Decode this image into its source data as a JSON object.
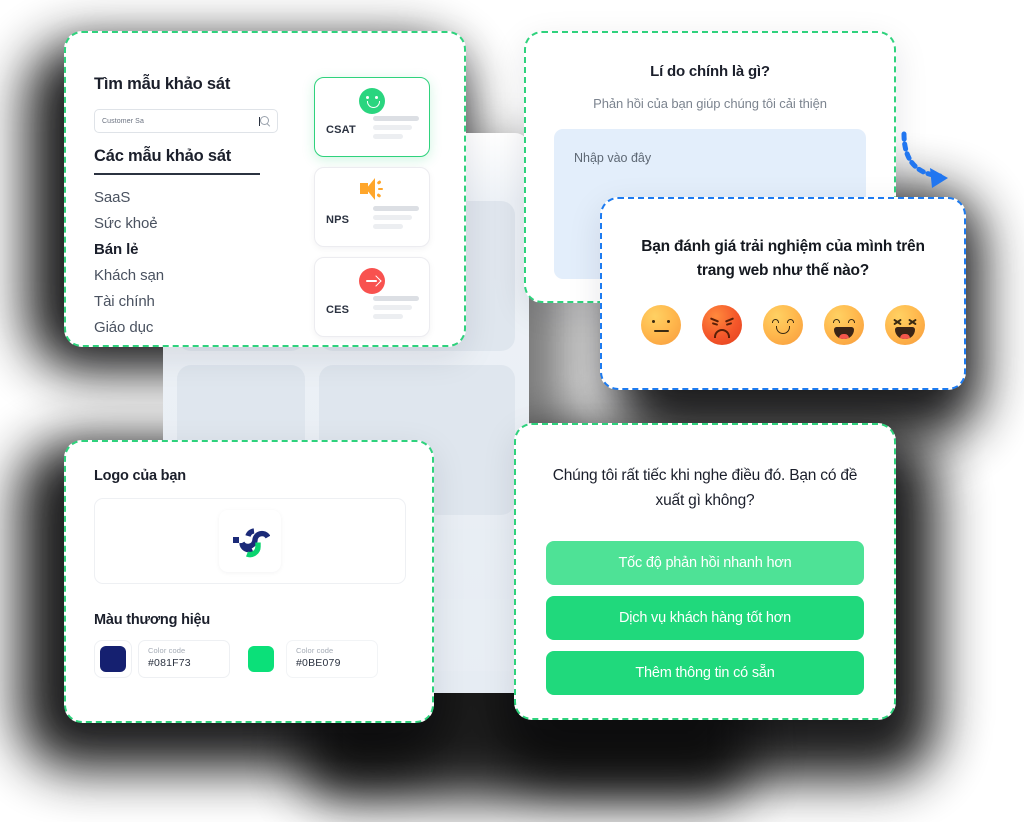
{
  "templates_card": {
    "title": "Tìm mẫu khảo sát",
    "search": {
      "value": "Customer Sa",
      "placeholder": "Customer Sa"
    },
    "list_heading": "Các mẫu khảo sát",
    "items": [
      {
        "label": "SaaS",
        "selected": false
      },
      {
        "label": "Sức khoẻ",
        "selected": false
      },
      {
        "label": "Bán lẻ",
        "selected": true
      },
      {
        "label": "Khách sạn",
        "selected": false
      },
      {
        "label": "Tài chính",
        "selected": false
      },
      {
        "label": "Giáo dục",
        "selected": false
      }
    ],
    "types": [
      {
        "label": "CSAT",
        "icon": "smile-icon",
        "active": true
      },
      {
        "label": "NPS",
        "icon": "speaker-icon",
        "active": false
      },
      {
        "label": "CES",
        "icon": "arrow-right-icon",
        "active": false
      }
    ]
  },
  "reason_card": {
    "question": "Lí do chính là gì?",
    "subtitle": "Phản hồi của bạn giúp chúng tôi cải thiện",
    "input_placeholder": "Nhập vào đây"
  },
  "rating_card": {
    "question": "Bạn đánh giá trải nghiệm của mình trên trang web như thế nào?",
    "emojis": [
      {
        "name": "neutral-face-emoji"
      },
      {
        "name": "angry-face-emoji"
      },
      {
        "name": "smiling-face-emoji"
      },
      {
        "name": "laughing-face-emoji"
      },
      {
        "name": "squinting-laughing-face-emoji"
      }
    ]
  },
  "brand_card": {
    "logo_heading": "Logo của bạn",
    "color_heading": "Màu thương hiệu",
    "colors": [
      {
        "label": "Color code",
        "value": "#081F73",
        "hex": "#152070"
      },
      {
        "label": "Color code",
        "value": "#0BE079",
        "hex": "#0BE079"
      }
    ]
  },
  "suggest_card": {
    "question": "Chúng tôi rất tiếc khi nghe điều đó. Bạn có đề xuất gì không?",
    "options": [
      {
        "label": "Tốc độ phản hồi nhanh hơn",
        "hovered": true
      },
      {
        "label": "Dịch vụ khách hàng tốt hơn",
        "hovered": false
      },
      {
        "label": "Thêm thông tin có sẵn",
        "hovered": false
      }
    ]
  },
  "accents": {
    "green": "#20d97c",
    "selection_green": "#2fd27d",
    "selection_blue": "#1d7bf0",
    "orange": "#FFA62B",
    "red": "#F8524F"
  }
}
